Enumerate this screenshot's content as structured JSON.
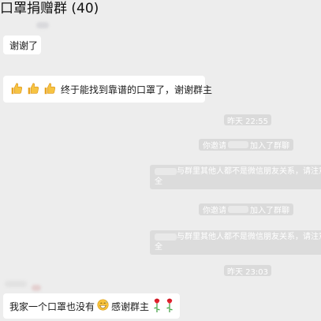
{
  "chat": {
    "title": "口罩捐赠群 (40)"
  },
  "messages": [
    {
      "text": "谢谢了"
    },
    {
      "emoji": [
        "thumbs-up-icon",
        "thumbs-up-icon",
        "thumbs-up-icon"
      ],
      "text": "终于能找到靠谱的口罩了，谢谢群主"
    },
    {
      "text_before": "我家一个口罩也没有",
      "emoji_mid": "grin-sweat-icon",
      "text_after": "感谢群主",
      "emoji_end": [
        "rose-icon",
        "rose-icon"
      ]
    }
  ],
  "system": {
    "time1": "昨天 22:55",
    "invite1_before": "你邀请",
    "invite1_after": "加入了群聊",
    "notice1_line1": "与群里其他人都不是微信朋友关系，请注意隐",
    "notice1_line2": "全",
    "invite2_before": "你邀请",
    "invite2_after": "加入了群聊",
    "notice2_line1": "与群里其他人都不是微信朋友关系，请注意隐",
    "notice2_line2": "全",
    "time2": "昨天 23:03"
  },
  "colors": {
    "background": "#ededed",
    "bubble": "#ffffff",
    "system_pill": "#dadada",
    "system_text": "#ffffff"
  }
}
